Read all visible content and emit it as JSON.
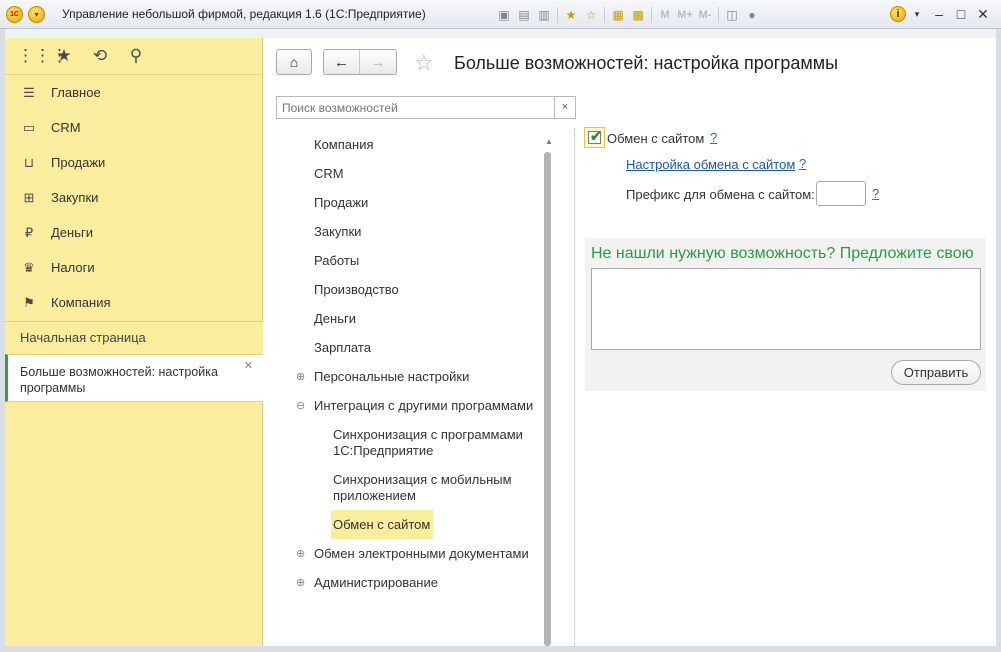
{
  "window": {
    "title": "Управление небольшой фирмой, редакция 1.6  (1С:Предприятие)",
    "logo_text": "1С",
    "toolbar_dim": [
      "M",
      "M+",
      "M-"
    ]
  },
  "sections": [
    {
      "label": "Главное",
      "icon": "menu-lines-icon"
    },
    {
      "label": "CRM",
      "icon": "contact-card-icon"
    },
    {
      "label": "Продажи",
      "icon": "basket-icon"
    },
    {
      "label": "Закупки",
      "icon": "cart-icon"
    },
    {
      "label": "Деньги",
      "icon": "ruble-coin-icon"
    },
    {
      "label": "Налоги",
      "icon": "emblem-icon"
    },
    {
      "label": "Компания",
      "icon": "flag-icon"
    }
  ],
  "open_pages": {
    "home": "Начальная страница",
    "current": "Больше возможностей: настройка программы"
  },
  "page": {
    "title": "Больше возможностей: настройка программы",
    "search_placeholder": "Поиск возможностей",
    "search_clear": "×"
  },
  "tree": [
    "Компания",
    "CRM",
    "Продажи",
    "Закупки",
    "Работы",
    "Производство",
    "Деньги",
    "Зарплата",
    "Персональные настройки",
    "Интеграция с другими программами",
    "Синхронизация с программами 1С:Предприятие",
    "Синхронизация с мобильным приложением",
    "Обмен с сайтом",
    "Обмен электронными документами",
    "Администрирование"
  ],
  "settings": {
    "exchange_checkbox_label": "Обмен с сайтом",
    "exchange_checked": true,
    "help": "?",
    "setup_link": "Настройка обмена с сайтом",
    "prefix_label": "Префикс для обмена с сайтом:",
    "prefix_value": ""
  },
  "suggest": {
    "title": "Не нашли нужную возможность? Предложите свою",
    "send_button": "Отправить"
  },
  "colors": {
    "section_bg": "#fbed9e",
    "accent_green": "#2c9a44",
    "link_blue": "#1f58a8"
  }
}
